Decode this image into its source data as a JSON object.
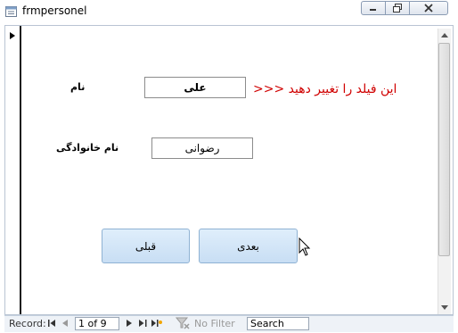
{
  "window": {
    "title": "frmpersonel",
    "icon": "form-icon"
  },
  "form": {
    "name_label": "نام",
    "name_value": "علی",
    "annotation": "این فیلد را تغییر دهید <<<",
    "family_label": "نام خانوادگی",
    "family_value": "رضوانی",
    "next_button": "بعدی",
    "prev_button": "قبلی"
  },
  "navigation": {
    "record_label": "Record:",
    "current": "1 of 9",
    "filter_label": "No Filter",
    "search_placeholder": "Search"
  },
  "colors": {
    "annotation": "#d00000",
    "button_bg": "#c8def4",
    "nav_bg": "#eef2f7"
  }
}
